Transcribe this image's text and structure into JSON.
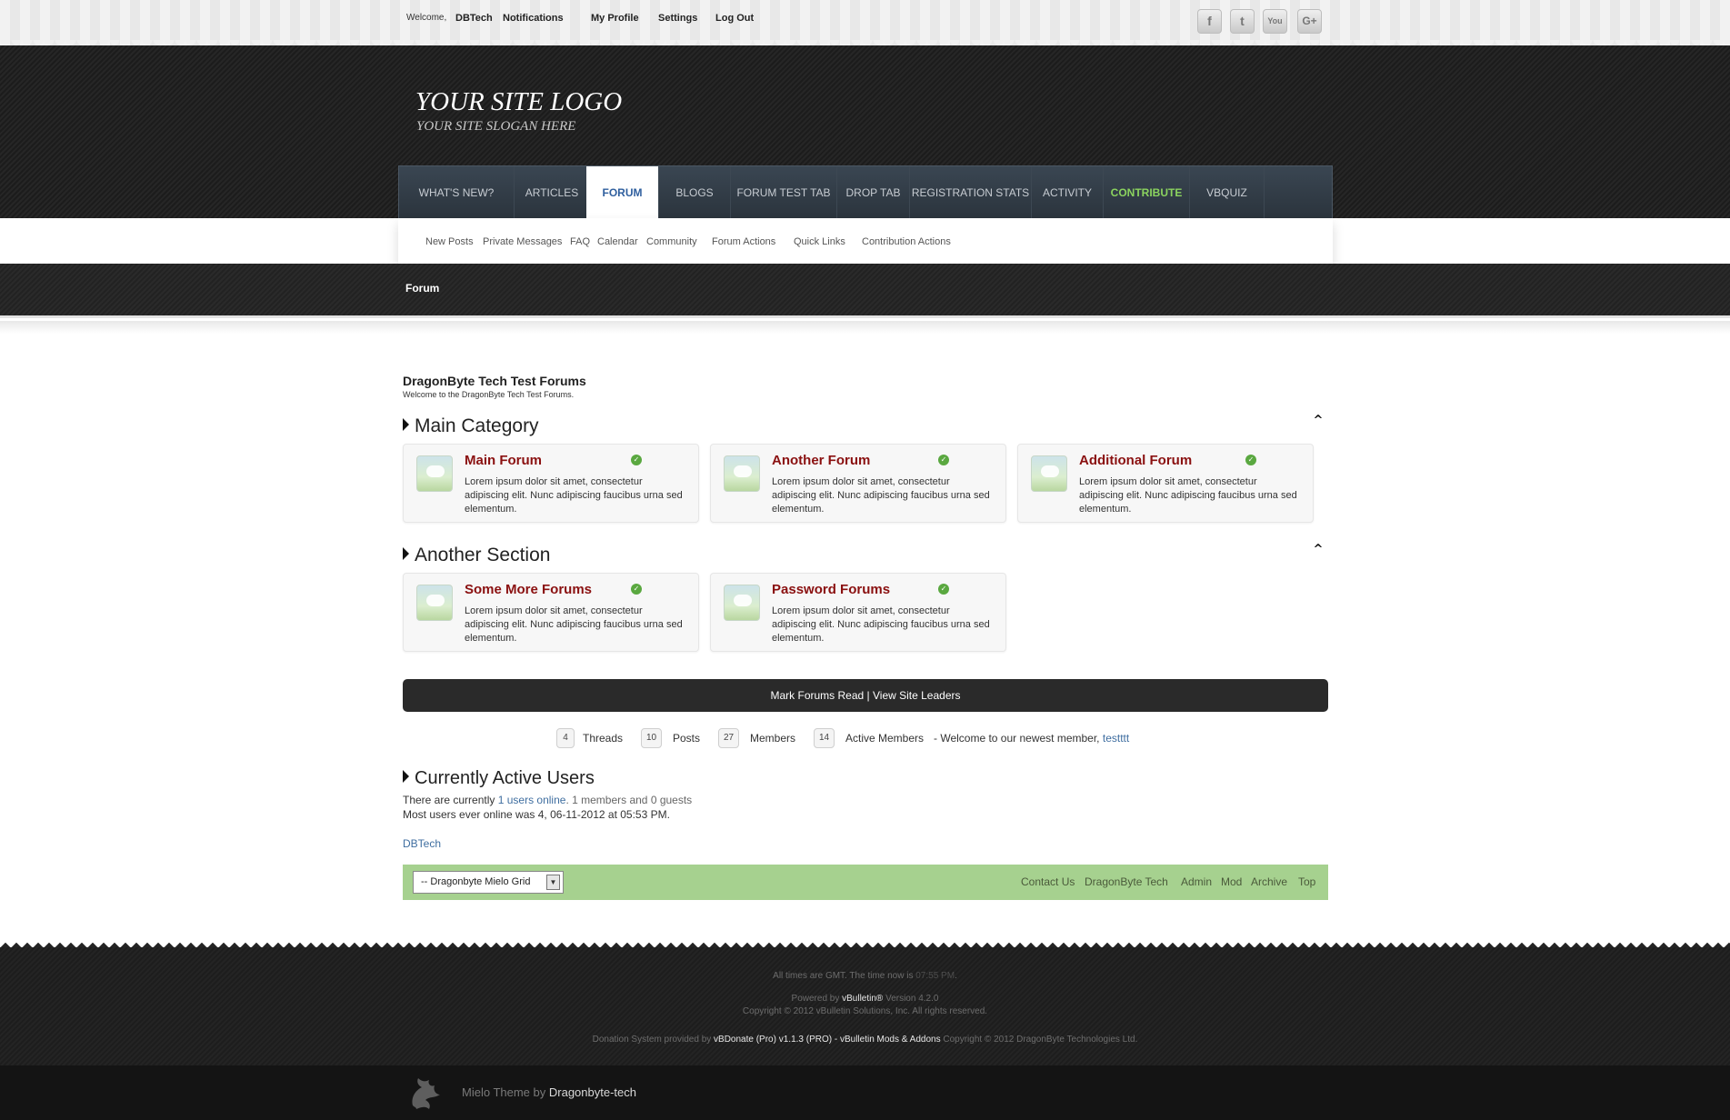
{
  "usernav": {
    "welcome": "Welcome,",
    "username": "DBTech",
    "notifications": "Notifications",
    "my_profile": "My Profile",
    "settings": "Settings",
    "logout": "Log Out"
  },
  "social": [
    "f",
    "t",
    "You",
    "G+"
  ],
  "social_icons": [
    "facebook-icon",
    "twitter-icon",
    "youtube-icon",
    "google-plus-icon"
  ],
  "logo": {
    "title": "YOUR SITE LOGO",
    "slogan": "YOUR SITE SLOGAN HERE"
  },
  "nav": {
    "tabs": [
      "WHAT'S NEW?",
      "ARTICLES",
      "FORUM",
      "BLOGS",
      "FORUM TEST TAB",
      "DROP TAB",
      "REGISTRATION STATS",
      "ACTIVITY",
      "CONTRIBUTE",
      "VBQUIZ"
    ],
    "active": "FORUM",
    "highlight": "CONTRIBUTE"
  },
  "subnav": [
    "New Posts",
    "Private Messages",
    "FAQ",
    "Calendar",
    "Community",
    "Forum Actions",
    "Quick Links",
    "Contribution Actions"
  ],
  "breadcrumb": "Forum",
  "page": {
    "title": "DragonByte Tech Test Forums",
    "description": "Welcome to the DragonByte Tech Test Forums."
  },
  "sections": [
    {
      "title": "Main Category",
      "forums": [
        {
          "title": "Main Forum",
          "description": "Lorem ipsum dolor sit amet, consectetur adipiscing elit. Nunc adipiscing faucibus urna sed elementum."
        },
        {
          "title": "Another Forum",
          "description": "Lorem ipsum dolor sit amet, consectetur adipiscing elit. Nunc adipiscing faucibus urna sed elementum."
        },
        {
          "title": "Additional Forum",
          "description": "Lorem ipsum dolor sit amet, consectetur adipiscing elit. Nunc adipiscing faucibus urna sed elementum."
        }
      ]
    },
    {
      "title": "Another Section",
      "forums": [
        {
          "title": "Some More Forums",
          "description": "Lorem ipsum dolor sit amet, consectetur adipiscing elit. Nunc adipiscing faucibus urna sed elementum."
        },
        {
          "title": "Password Forums",
          "description": "Lorem ipsum dolor sit amet, consectetur adipiscing elit. Nunc adipiscing faucibus urna sed elementum."
        }
      ]
    }
  ],
  "actions": {
    "mark_read": "Mark Forums Read",
    "separator": " | ",
    "site_leaders": "View Site Leaders"
  },
  "stats": {
    "threads": {
      "value": "4",
      "label": "Threads"
    },
    "posts": {
      "value": "10",
      "label": "Posts"
    },
    "members": {
      "value": "27",
      "label": "Members"
    },
    "active": {
      "value": "14",
      "label": "Active Members"
    },
    "newest_prefix": "- Welcome to our newest member,",
    "newest_member": "testttt"
  },
  "active_users": {
    "title": "Currently Active Users",
    "line1_prefix": "There are currently",
    "line1_link": "1 users online",
    "line1_suffix": ". 1 members and 0 guests",
    "line2": "Most users ever online was 4, 06-11-2012 at 05:53 PM.",
    "user": "DBTech"
  },
  "footer": {
    "style_select": "-- Dragonbyte Mielo Grid",
    "links": [
      "Contact Us",
      "DragonByte Tech",
      "Admin",
      "Mod",
      "Archive",
      "Top"
    ]
  },
  "bottom": {
    "time_prefix": "All times are GMT. The time now is",
    "time_value": "07:55 PM",
    "time_suffix": ".",
    "powered_prefix": "Powered by",
    "powered_brand": "vBulletin®",
    "powered_version": "Version 4.2.0",
    "copyright": "Copyright © 2012 vBulletin Solutions, Inc. All rights reserved.",
    "donation_prefix": "Donation System provided by",
    "donation_product": "vBDonate (Pro) v1.1.3 (PRO) - vBulletin Mods & Addons",
    "donation_copyright": "Copyright © 2012 DragonByte Technologies Ltd.",
    "theme_prefix": "Mielo Theme by",
    "theme_author": "Dragonbyte-tech"
  },
  "colors": {
    "forum_title": "#8a1010",
    "active_tab": "#2f5f9e",
    "contribute": "#8bd35f",
    "footer_bar": "#a6d18f",
    "link": "#3f6ea0"
  }
}
